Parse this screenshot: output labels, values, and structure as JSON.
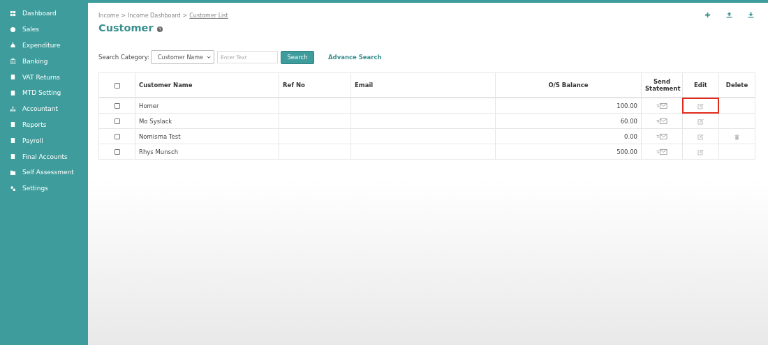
{
  "sidebar": {
    "items": [
      {
        "label": "Dashboard",
        "selected": false
      },
      {
        "label": "Sales",
        "selected": false
      },
      {
        "label": "Expenditure",
        "selected": false
      },
      {
        "label": "Banking",
        "selected": false
      },
      {
        "label": "VAT Returns",
        "selected": false
      },
      {
        "label": "MTD Setting",
        "selected": false
      },
      {
        "label": "Accountant",
        "selected": false
      },
      {
        "label": "Reports",
        "selected": false
      },
      {
        "label": "Payroll",
        "selected": false
      },
      {
        "label": "Final Accounts",
        "selected": false
      },
      {
        "label": "Self Assessment",
        "selected": false
      },
      {
        "label": "Settings",
        "selected": false
      }
    ]
  },
  "breadcrumb": [
    "Income",
    "Income Dashboard",
    "Customer List"
  ],
  "breadcrumb_separator": ">",
  "title": "Customer",
  "search": {
    "label": "Search Category:",
    "category": "Customer Name",
    "placeholder": "Enter Text",
    "button": "Search",
    "advanced": "Advance Search"
  },
  "table": {
    "select_all_checked": false,
    "columns": [
      "Customer Name",
      "Ref No",
      "Email",
      "O/S Balance",
      "Send Statement",
      "Edit",
      "Delete"
    ],
    "rows": [
      {
        "checked": false,
        "name": "Homer",
        "balance": "100.00",
        "deletable": false,
        "highlighted": true
      },
      {
        "checked": false,
        "name": "Mo Syslack",
        "balance": "60.00",
        "deletable": false,
        "highlighted": false
      },
      {
        "checked": false,
        "name": "Nomisma Test",
        "balance": "0.00",
        "deletable": true,
        "highlighted": false
      },
      {
        "checked": false,
        "name": "Rhys Munsch",
        "balance": "500.00",
        "deletable": false,
        "highlighted": false
      }
    ]
  }
}
